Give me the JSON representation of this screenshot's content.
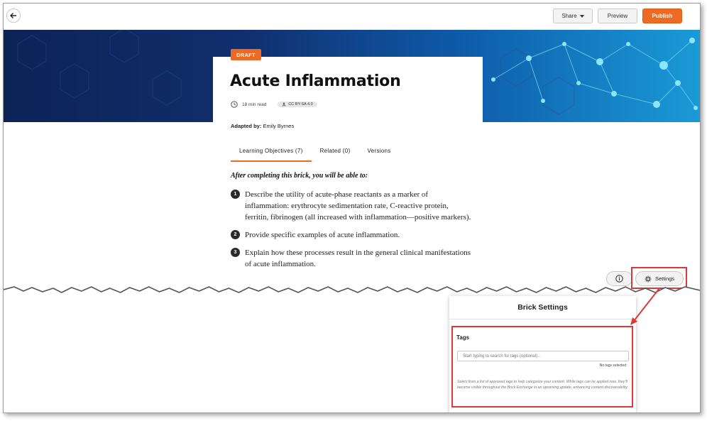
{
  "topbar": {
    "share_label": "Share",
    "preview_label": "Preview",
    "publish_label": "Publish"
  },
  "brick": {
    "status": "DRAFT",
    "title": "Acute Inflammation",
    "read_time": "18 min read",
    "license": "CC BY-SA 4.0",
    "adapted_by_label": "Adapted by:",
    "adapted_by_name": "Emily Byrnes"
  },
  "tabs": [
    {
      "label": "Learning Objectives (7)",
      "active": true
    },
    {
      "label": "Related (0)",
      "active": false
    },
    {
      "label": "Versions",
      "active": false
    }
  ],
  "objectives": {
    "intro": "After completing this brick, you will be able to:",
    "items": [
      {
        "num": "1",
        "text": "Describe the utility of acute-phase reactants as a marker of inflammation: erythrocyte sedimentation rate, C-reactive protein, ferritin, fibrinogen (all increased with inflammation—positive markers)."
      },
      {
        "num": "2",
        "text": "Provide specific examples of acute inflammation."
      },
      {
        "num": "3",
        "text": "Explain how these processes result in the general clinical manifestations of acute inflammation."
      }
    ]
  },
  "controls": {
    "settings_label": "Settings"
  },
  "settings_panel": {
    "title": "Brick Settings",
    "tags_label": "Tags",
    "tags_placeholder": "Start typing to search for tags (optional)...",
    "no_tags_text": "No tags selected",
    "help_text": "Select from a list of approved tags to help categorize your content. While tags can be applied now, they'll become visible throughout the Brick Exchange in an upcoming update, enhancing content discoverability."
  },
  "colors": {
    "accent": "#ee6a24",
    "highlight": "#d93a3a",
    "hero_dark": "#0c2356",
    "hero_light": "#1a9ad6"
  }
}
